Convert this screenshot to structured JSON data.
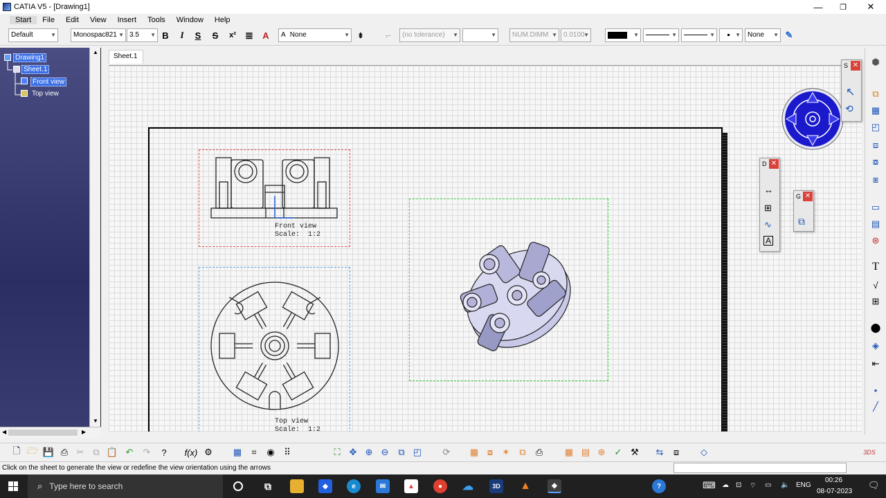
{
  "window": {
    "title": "CATIA V5 - [Drawing1]",
    "minimize": "—",
    "restore": "❐",
    "close": "✕"
  },
  "menu": [
    "Start",
    "File",
    "Edit",
    "View",
    "Insert",
    "Tools",
    "Window",
    "Help"
  ],
  "format_toolbar": {
    "style": "Default",
    "font": "Monospac821",
    "font_size": "3.5",
    "bold": "B",
    "italic": "I",
    "underline": "S",
    "strike": "S",
    "superscript": "x²",
    "frame": "None",
    "tolerance": "(no tolerance)",
    "num_format": "NUM.DIMM",
    "precision": "0.0100",
    "line_none": "None"
  },
  "tree": {
    "root": "Drawing1",
    "sheet": "Sheet.1",
    "views": [
      "Front view",
      "Top view"
    ]
  },
  "sheet_tab": "Sheet.1",
  "views": {
    "front": {
      "label": "Front view",
      "scale": "Scale:  1:2"
    },
    "top": {
      "label": "Top view",
      "scale": "Scale:  1:2"
    }
  },
  "floating_panels": [
    "S",
    "D",
    "G"
  ],
  "status": {
    "message": "Click on the sheet to generate the view or redefine the view orientation using the arrows"
  },
  "taskbar": {
    "search_placeholder": "Type here to search",
    "lang": "ENG",
    "time": "00:26",
    "date": "08-07-2023"
  },
  "colors": {
    "front_frame": "#e05050",
    "top_frame": "#5a9be0",
    "iso_frame": "#3fcf3f",
    "compass": "#1a1acc"
  }
}
